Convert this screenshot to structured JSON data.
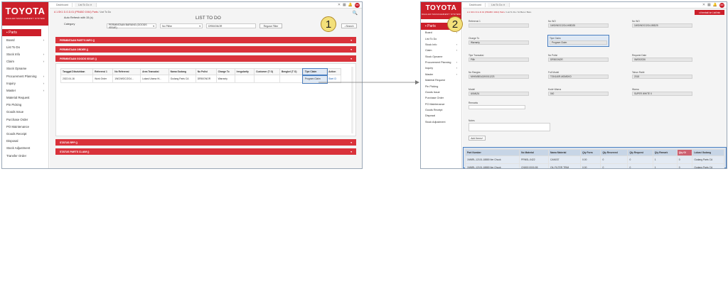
{
  "brand": {
    "logo": "TOYOTA",
    "tagline": "DEALER MANAGEMENT SYSTEM",
    "accent": "#cc1f2a"
  },
  "callouts": [
    "1",
    "2"
  ],
  "screen1": {
    "tabs": [
      "Dashboard",
      "List To Do"
    ],
    "user_initials": "RR",
    "breadcrumb": "A 1.SK1 D.G.D.01 (PRABO 1944) Parts",
    "breadcrumb_tail": " / List To Do",
    "auto_refresh_label": "Auto Refresh with 15 (s)",
    "page_title": "LIST TO DO",
    "filter_category_label": "Category",
    "filter_category_value": "PERMINTAAN BARANG (GOODS ISSUE)",
    "filter_status_value": "No Pilihe",
    "filter_text_value": "DR50GNOR",
    "filter_button": "Reguse Filter",
    "search_button": "Search",
    "sidebar_active": "Parts",
    "sidebar": [
      "Board",
      "List To Do",
      "Stock Info",
      "Claim",
      "Stock Opname",
      "Procurement Planning",
      "Inquiry",
      "Master",
      "Material Request",
      "Pin Picking",
      "Goods Issue",
      "Purchase Order",
      "PO Maintenance",
      "Goods Receipt",
      "Disposal",
      "Stock Adjustment",
      "Transfer Order"
    ],
    "sections_top": [
      "PERMINTAAN PART'S INFO ()",
      "PERMINTAAN ORDER ()",
      "PERMINTAAN GOODS ISSUE ()"
    ],
    "sections_bottom": [
      "STATUS RPP ()",
      "STATUS PARTS CLAIM ()"
    ],
    "table_headers": [
      "Tanggal Dibutuhkan",
      "Referensi 1",
      "No Referensi",
      "Area Transaksi",
      "Nama Gudang",
      "No Polisi",
      "Charge To",
      "Irregularity",
      "Customer (T O)",
      "Bengkel (T O)",
      "Tipe Claim",
      "Action"
    ],
    "table_rows": [
      [
        "2022-04-16",
        "Work Order",
        "1WO/WOC/2G4...",
        "Lokasi Utama Hi...",
        "Gudang Parts CA",
        "DR50GNOR",
        "Warranty",
        "",
        "",
        "",
        "Program Claim",
        "Start Cl"
      ]
    ]
  },
  "screen2": {
    "tabs": [
      "Dashboard",
      "List To Do"
    ],
    "user_initials": "RR",
    "breadcrumb": "A 1.SK1 D.G.D.01 (PRABO 1944) Parts",
    "breadcrumb_tail": " / List To Do / GI Baru / Baru",
    "sidebar_active": "Parts",
    "sidebar": [
      "Board",
      "List To Do",
      "Stock Info",
      "Claim",
      "Stock Opname",
      "Procurement Planning",
      "Inquiry",
      "Master",
      "Material Request",
      "Pin Picking",
      "Goods Issue",
      "Purchase Order",
      "PO Maintenance",
      "Goods Receipt",
      "Disposal",
      "Stock Adjustment"
    ],
    "action_button": "Kembali ke List/Info",
    "fields": [
      {
        "label": "Referensi 1",
        "value": ""
      },
      {
        "label": "No WO",
        "value": "1WO/WOC/2G4-H/BD25"
      },
      {
        "label": "No WO",
        "value": "1WO/WOC/2G4-0BD25"
      },
      {
        "label": "Charge To",
        "value": "Warranty"
      },
      {
        "label": "Tipe Claim",
        "value": "Program Claim"
      },
      {
        "label": "Tipe Transaksi",
        "value": "Pilih"
      },
      {
        "label": "No Polisi",
        "value": "DR50GNOR"
      },
      {
        "label": "Request Date",
        "value": "06/05/2026"
      },
      {
        "label": "No Rangka",
        "value": "MHKM5EA3JK0011223"
      },
      {
        "label": "Full Model",
        "value": "TGN140R-MDMDKD"
      },
      {
        "label": "Tahun Rakit",
        "value": "2018"
      },
      {
        "label": "Model",
        "value": "AVANZA"
      },
      {
        "label": "Kode Warna",
        "value": "040"
      },
      {
        "label": "Warna",
        "value": "SUPER WHITE II"
      }
    ],
    "remarks_label": "Remarks",
    "notes_label": "Notes",
    "add_button": "Add Items",
    "table_headers": [
      "Part Number",
      "No Material",
      "Nama Material",
      "Qty Form",
      "Qty Reserved",
      "Qty Request",
      "Qty Remark",
      "Qty GI",
      "Lokasi Gudang"
    ],
    "table_rows": [
      [
        "1MNRL-12101-18880 Iter Chuck",
        "PRNSL-0422",
        "CAN037",
        "0.00",
        "0",
        "0",
        "1",
        "0",
        "Gudang Parts CA"
      ],
      [
        "1MNRL-12101-18880 Iter Chuck",
        "CN500 0000-55",
        "OIL FILTER TRIM",
        "0.00",
        "0",
        "0",
        "1",
        "0",
        "Gudang Parts CA"
      ]
    ]
  }
}
